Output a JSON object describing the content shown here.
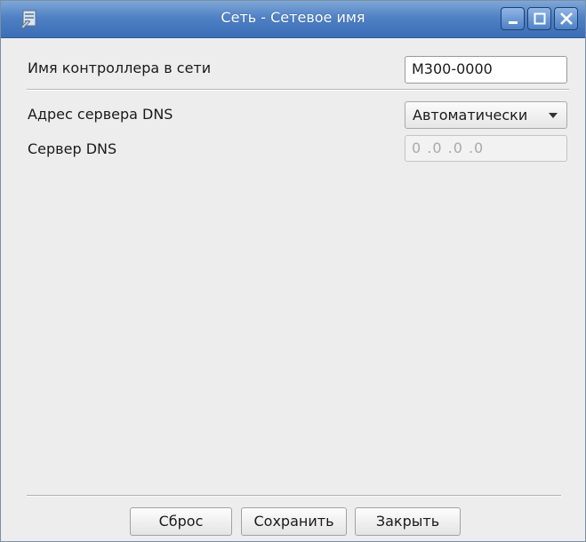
{
  "window": {
    "title": "Сеть - Сетевое имя",
    "icon": "app-window-icon",
    "controls": [
      "minimize-icon",
      "maximize-icon",
      "close-icon"
    ]
  },
  "form": {
    "controller_name": {
      "label": "Имя контроллера в сети",
      "value": "M300-0000"
    },
    "dns_address": {
      "label": "Адрес сервера DNS",
      "selected": "Автоматически"
    },
    "dns_server": {
      "label": "Сервер DNS",
      "value": "0 .0 .0 .0"
    }
  },
  "buttons": {
    "reset": "Сброс",
    "save": "Сохранить",
    "close": "Закрыть"
  },
  "colors": {
    "titlebar": "#4f81c4",
    "background": "#ededed"
  }
}
